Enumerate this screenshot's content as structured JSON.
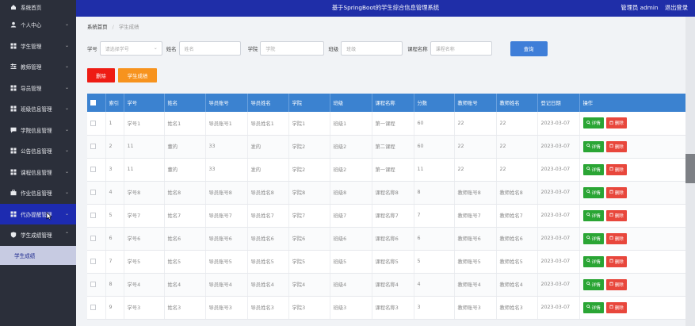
{
  "header": {
    "title": "基于SpringBoot的学生综合信息管理系统",
    "user": "管理员 admin",
    "logout": "退出登录"
  },
  "sidebar": {
    "home": "系统首页",
    "items": [
      {
        "label": "个人中心",
        "icon": "user-icon"
      },
      {
        "label": "学生管理",
        "icon": "grid-icon"
      },
      {
        "label": "教师管理",
        "icon": "sliders-icon"
      },
      {
        "label": "导员管理",
        "icon": "grid-icon"
      },
      {
        "label": "班级信息管理",
        "icon": "grid-icon"
      },
      {
        "label": "学院信息管理",
        "icon": "chat-icon"
      },
      {
        "label": "公告信息管理",
        "icon": "grid-icon"
      },
      {
        "label": "课程信息管理",
        "icon": "grid-icon"
      },
      {
        "label": "作业信息管理",
        "icon": "briefcase-icon"
      },
      {
        "label": "代办提醒管理",
        "icon": "grid-icon"
      },
      {
        "label": "学生成绩管理",
        "icon": "shield-icon"
      }
    ],
    "sub_item": "学生成绩"
  },
  "breadcrumb": {
    "home": "系统首页",
    "sep": "/",
    "current": "学生成绩"
  },
  "search": {
    "fields": [
      {
        "label": "学号",
        "placeholder": "请选择学号"
      },
      {
        "label": "姓名",
        "placeholder": "姓名"
      },
      {
        "label": "学院",
        "placeholder": "学院"
      },
      {
        "label": "班级",
        "placeholder": "班级"
      },
      {
        "label": "课程名称",
        "placeholder": "课程名称"
      }
    ],
    "button": "查询"
  },
  "actions": {
    "delete": "删除",
    "score": "学生成绩"
  },
  "table": {
    "headers": [
      "索引",
      "学号",
      "姓名",
      "导员账号",
      "导员姓名",
      "学院",
      "班级",
      "课程名称",
      "分数",
      "教师账号",
      "教师姓名",
      "登记日期",
      "操作"
    ],
    "detail_label": "详情",
    "delete_label": "删除",
    "rows": [
      [
        "1",
        "学号1",
        "姓名1",
        "导员账号1",
        "导员姓名1",
        "学院1",
        "班级1",
        "第一课程",
        "60",
        "22",
        "22",
        "2023-03-07"
      ],
      [
        "2",
        "11",
        "董的",
        "33",
        "发的",
        "学院2",
        "班级2",
        "第二课程",
        "60",
        "22",
        "22",
        "2023-03-07"
      ],
      [
        "3",
        "11",
        "董的",
        "33",
        "发的",
        "学院2",
        "班级2",
        "第一课程",
        "11",
        "22",
        "22",
        "2023-03-07"
      ],
      [
        "4",
        "学号8",
        "姓名8",
        "导员账号8",
        "导员姓名8",
        "学院8",
        "班级8",
        "课程名称8",
        "8",
        "教师账号8",
        "教师姓名8",
        "2023-03-07"
      ],
      [
        "5",
        "学号7",
        "姓名7",
        "导员账号7",
        "导员姓名7",
        "学院7",
        "班级7",
        "课程名称7",
        "7",
        "教师账号7",
        "教师姓名7",
        "2023-03-07"
      ],
      [
        "6",
        "学号6",
        "姓名6",
        "导员账号6",
        "导员姓名6",
        "学院6",
        "班级6",
        "课程名称6",
        "6",
        "教师账号6",
        "教师姓名6",
        "2023-03-07"
      ],
      [
        "7",
        "学号5",
        "姓名5",
        "导员账号5",
        "导员姓名5",
        "学院5",
        "班级5",
        "课程名称5",
        "5",
        "教师账号5",
        "教师姓名5",
        "2023-03-07"
      ],
      [
        "8",
        "学号4",
        "姓名4",
        "导员账号4",
        "导员姓名4",
        "学院4",
        "班级4",
        "课程名称4",
        "4",
        "教师账号4",
        "教师姓名4",
        "2023-03-07"
      ],
      [
        "9",
        "学号3",
        "姓名3",
        "导员账号3",
        "导员姓名3",
        "学院3",
        "班级3",
        "课程名称3",
        "3",
        "教师账号3",
        "教师姓名3",
        "2023-03-07"
      ]
    ]
  },
  "colors": {
    "header": "#1f2ea8",
    "sidebar": "#2b2f3a",
    "table_header": "#3b82d0",
    "delete": "#ee1c14",
    "score": "#f7931e",
    "detail": "#2aa534"
  }
}
